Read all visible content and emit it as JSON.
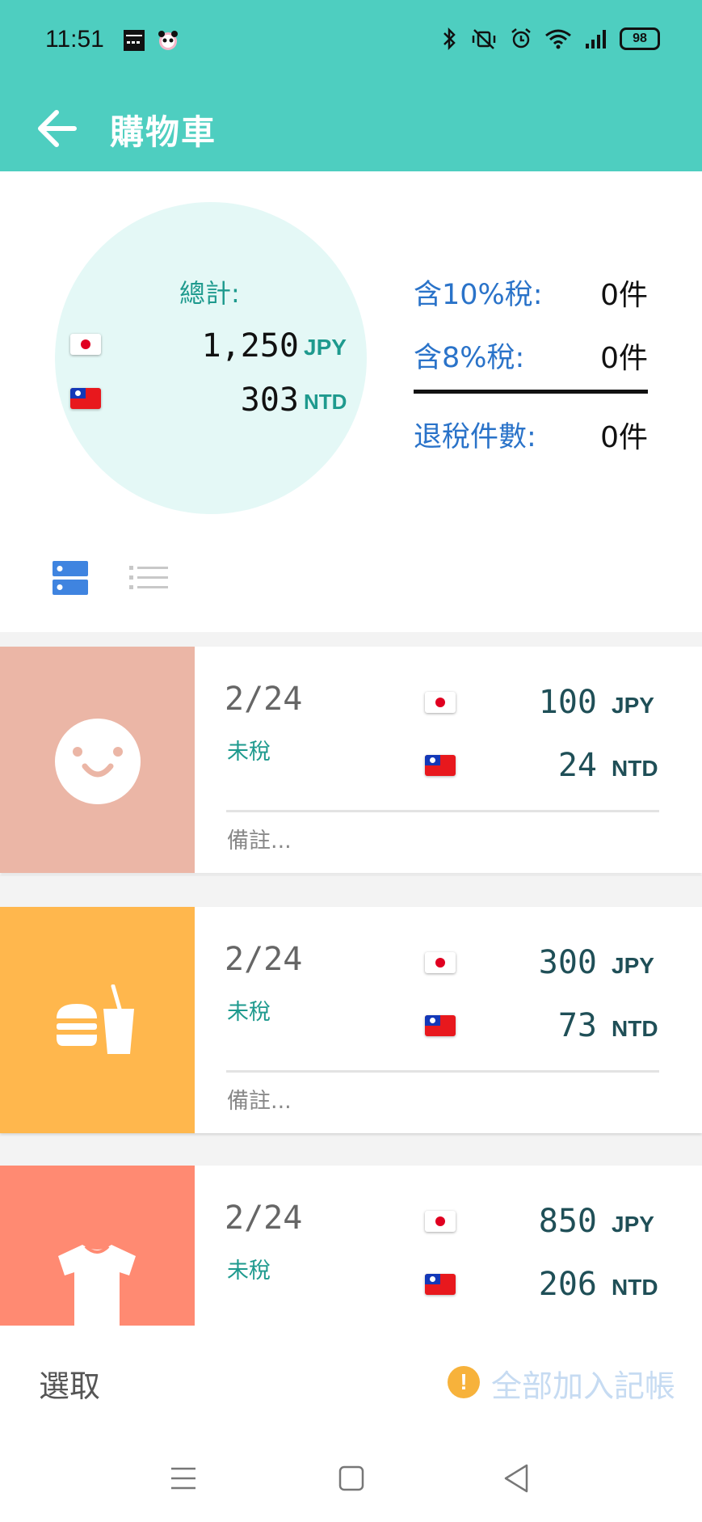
{
  "status_bar": {
    "time": "11:51",
    "notification_icons": [
      "app-notification-icon",
      "panda-app-icon"
    ],
    "system_icons": [
      "bluetooth-icon",
      "vibrate-mute-icon",
      "alarm-icon",
      "wifi-icon",
      "signal-icon"
    ],
    "battery": "98"
  },
  "app_bar": {
    "title": "購物車",
    "back_icon": "arrow-left-icon"
  },
  "summary": {
    "total_label": "總計:",
    "jpy_amount": "1,250",
    "jpy_currency": "JPY",
    "ntd_amount": "303",
    "ntd_currency": "NTD",
    "tax10_label": "含10%稅:",
    "tax10_value": "0件",
    "tax8_label": "含8%稅:",
    "tax8_value": "0件",
    "refund_label": "退稅件數:",
    "refund_value": "0件"
  },
  "view_toggle": {
    "active": "card-view",
    "options": [
      "card-view-icon",
      "list-view-icon"
    ]
  },
  "items": [
    {
      "icon": "smiley-face-icon",
      "color": "#ebb6a6",
      "date": "2/24",
      "status": "未稅",
      "jpy": "100",
      "jpy_cur": "JPY",
      "ntd": "24",
      "ntd_cur": "NTD",
      "note": "備註..."
    },
    {
      "icon": "burger-drink-icon",
      "color": "#ffb74d",
      "date": "2/24",
      "status": "未稅",
      "jpy": "300",
      "jpy_cur": "JPY",
      "ntd": "73",
      "ntd_cur": "NTD",
      "note": "備註..."
    },
    {
      "icon": "tshirt-icon",
      "color": "#ff8a72",
      "date": "2/24",
      "status": "未稅",
      "jpy": "850",
      "jpy_cur": "JPY",
      "ntd": "206",
      "ntd_cur": "NTD",
      "note": ""
    }
  ],
  "bottom_bar": {
    "select_label": "選取",
    "add_all_label": "全部加入記帳",
    "warning_icon": "!"
  },
  "colors": {
    "primary": "#4ecec0",
    "teal_text": "#1e9a8e",
    "blue_text": "#2a73c9",
    "warning": "#f7b23b"
  },
  "nav_bar": {
    "icons": [
      "menu-icon",
      "home-icon",
      "back-triangle-icon"
    ]
  }
}
